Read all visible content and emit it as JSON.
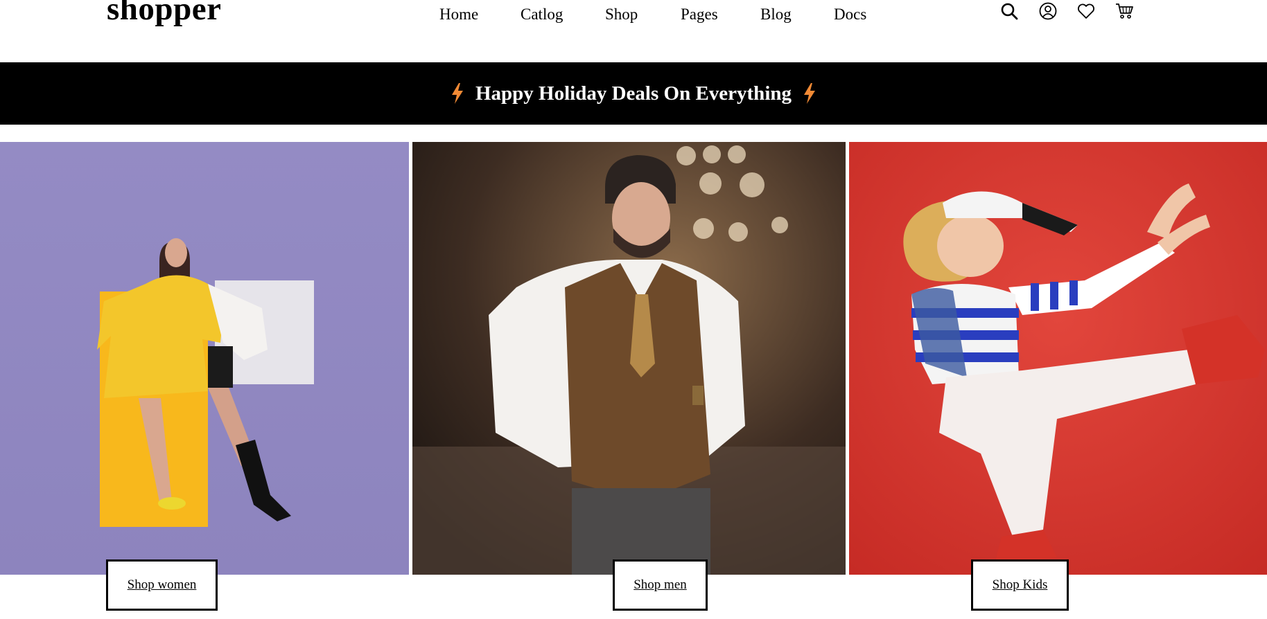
{
  "header": {
    "logo": "shopper",
    "nav": [
      "Home",
      "Catlog",
      "Shop",
      "Pages",
      "Blog",
      "Docs"
    ],
    "icons": [
      "search-icon",
      "user-icon",
      "heart-icon",
      "cart-icon"
    ]
  },
  "banner": {
    "text": "Happy Holiday Deals On Everything",
    "bolt_color": "#f28a35",
    "background": "#000000"
  },
  "panels": [
    {
      "name": "women",
      "background": "#9188c2",
      "button": "Shop women"
    },
    {
      "name": "men",
      "background": "#3a2a20",
      "button": "Shop men"
    },
    {
      "name": "kids",
      "background": "#d83a32",
      "button": "Shop Kids"
    }
  ]
}
